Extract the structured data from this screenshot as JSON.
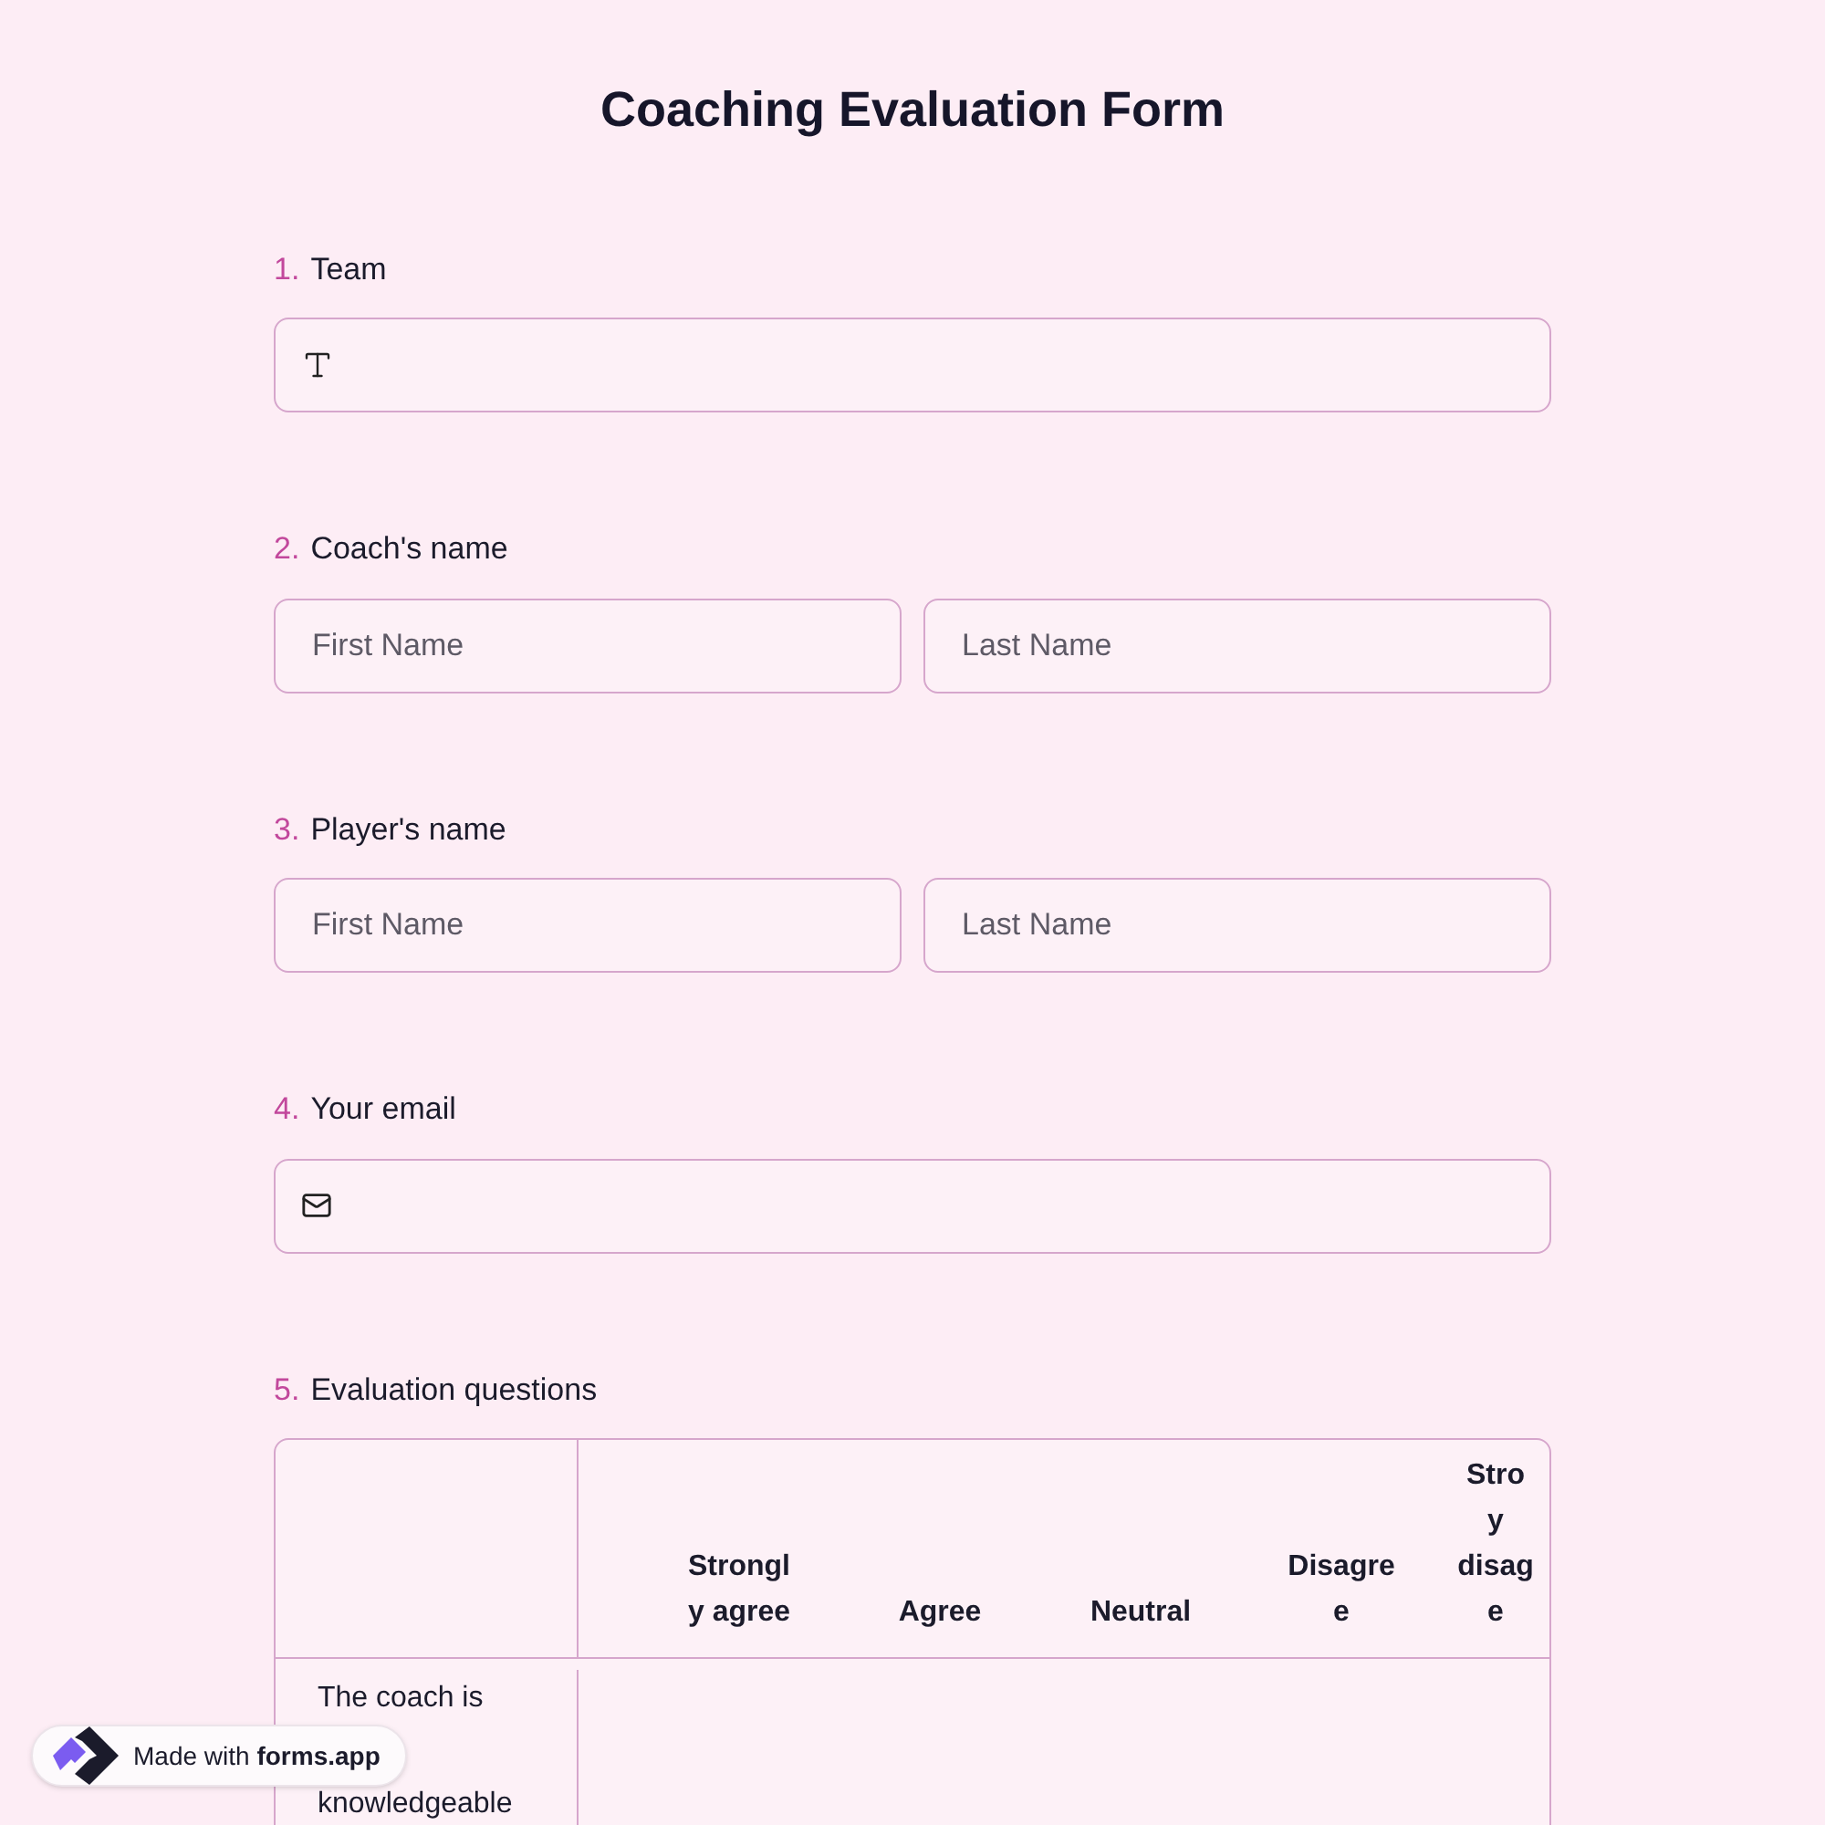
{
  "title": "Coaching Evaluation Form",
  "questions": [
    {
      "kind": "text",
      "number": "1.",
      "label": "Team"
    },
    {
      "kind": "name",
      "number": "2.",
      "label": "Coach's name",
      "fields": [
        {
          "placeholder": "First Name"
        },
        {
          "placeholder": "Last Name"
        }
      ]
    },
    {
      "kind": "name",
      "number": "3.",
      "label": "Player's name",
      "fields": [
        {
          "placeholder": "First Name"
        },
        {
          "placeholder": "Last Name"
        }
      ]
    },
    {
      "kind": "email",
      "number": "4.",
      "label": "Your email"
    },
    {
      "kind": "matrix",
      "number": "5.",
      "label": "Evaluation questions",
      "columns": [
        [
          "Strongl",
          "y agree"
        ],
        [
          "Agree"
        ],
        [
          "Neutral"
        ],
        [
          "Disagre",
          "e"
        ],
        [
          "Stro",
          "y",
          "disag",
          "e"
        ]
      ],
      "rows": [
        {
          "lines": [
            "The coach is",
            "knowledgeable"
          ]
        }
      ]
    }
  ],
  "badge": {
    "prefix": "Made with",
    "brand": "forms.app"
  }
}
